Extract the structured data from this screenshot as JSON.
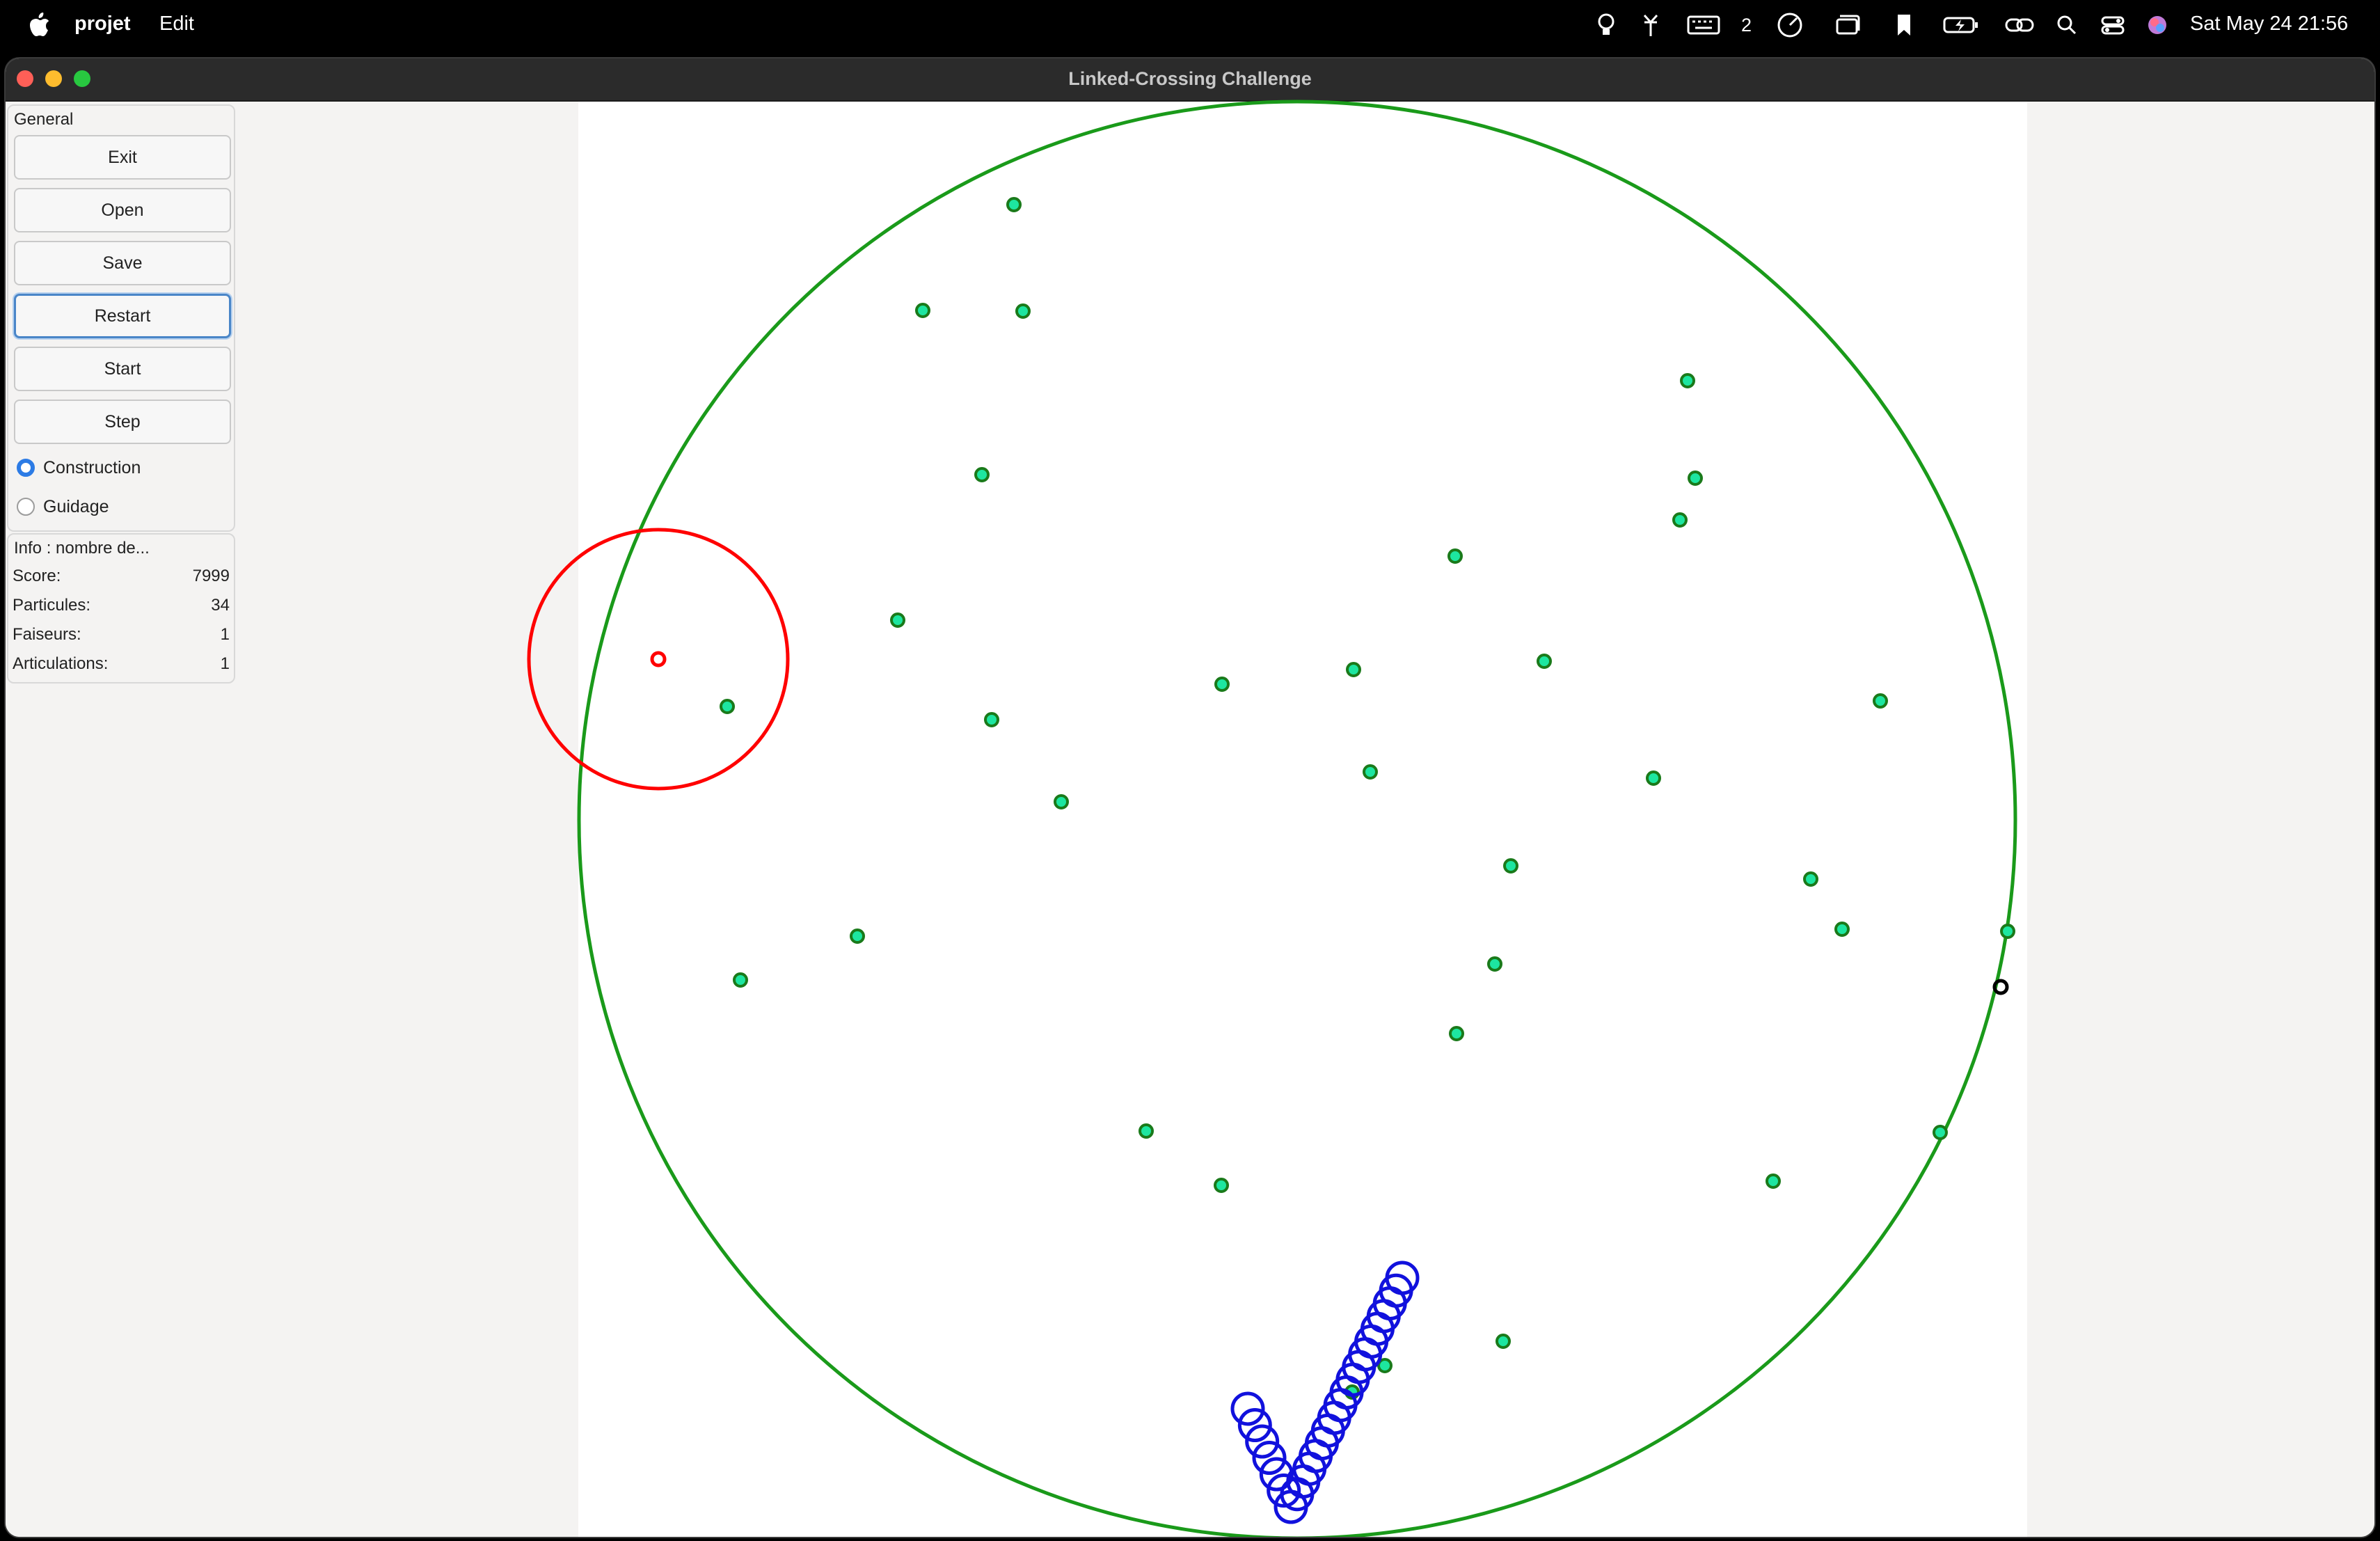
{
  "menubar": {
    "app_name": "projet",
    "menu_edit": "Edit",
    "desktop_number": "2",
    "datetime": "Sat May 24  21:56"
  },
  "window": {
    "title": "Linked-Crossing Challenge"
  },
  "panel": {
    "group_title": "General",
    "buttons": {
      "exit": "Exit",
      "open": "Open",
      "save": "Save",
      "restart": "Restart",
      "start": "Start",
      "step": "Step"
    },
    "modes": {
      "construction": "Construction",
      "guidage": "Guidage",
      "selected": "Construction"
    }
  },
  "info": {
    "title": "Info : nombre de...",
    "score_label": "Score:",
    "score_value": "7999",
    "particules_label": "Particules:",
    "particules_value": "34",
    "faiseurs_label": "Faiseurs:",
    "faiseurs_value": "1",
    "articulations_label": "Articulations:",
    "articulations_value": "1"
  },
  "colors": {
    "boundary": "#1a9a1a",
    "particle_fill": "#1de6a0",
    "particle_stroke": "#1a7a1a",
    "faiseur": "#ff0000",
    "chain": "#1111dd",
    "articulation": "#000000"
  }
}
